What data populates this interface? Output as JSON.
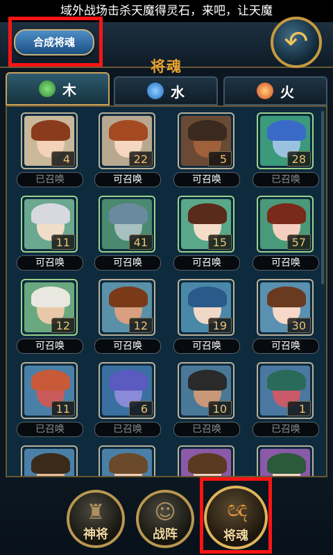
{
  "marquee": "域外战场击杀天魔得灵石，来吧，让天魔",
  "header": {
    "compose_label": "合成将魂",
    "title": "将魂",
    "back_icon": "back-arrow-icon"
  },
  "tabs": [
    {
      "label": "木",
      "icon": "leaf-icon"
    },
    {
      "label": "水",
      "icon": "water-drop-icon"
    },
    {
      "label": "火",
      "icon": "fire-icon"
    }
  ],
  "cards": [
    {
      "count": "4",
      "status": "已召唤",
      "state": "done",
      "bg": "#c9b89a",
      "hair": "#8a3b1e",
      "skin": "#f2d2b8",
      "frame": "plain"
    },
    {
      "count": "22",
      "status": "可召唤",
      "state": "can",
      "bg": "#b9a890",
      "hair": "#a44a22",
      "skin": "#f5d7c0",
      "frame": "plain"
    },
    {
      "count": "5",
      "status": "可召唤",
      "state": "can",
      "bg": "#6b4a35",
      "hair": "#3a2a20",
      "skin": "#a0603a",
      "frame": "plain"
    },
    {
      "count": "28",
      "status": "已召唤",
      "state": "done",
      "bg": "#3a9a7a",
      "hair": "#3a6ac8",
      "skin": "#9ac2e0",
      "frame": "green"
    },
    {
      "count": "11",
      "status": "可召唤",
      "state": "can",
      "bg": "#6aa890",
      "hair": "#d8d8e0",
      "skin": "#f0dcc8",
      "frame": "green"
    },
    {
      "count": "41",
      "status": "可召唤",
      "state": "can",
      "bg": "#4a8a70",
      "hair": "#6a8aa0",
      "skin": "#a8c0c0",
      "frame": "green"
    },
    {
      "count": "15",
      "status": "可召唤",
      "state": "can",
      "bg": "#5aa88a",
      "hair": "#5a2a1a",
      "skin": "#f5dcc8",
      "frame": "green"
    },
    {
      "count": "57",
      "status": "可召唤",
      "state": "can",
      "bg": "#4a9a7a",
      "hair": "#7a2a1a",
      "skin": "#f5d0c0",
      "frame": "green"
    },
    {
      "count": "12",
      "status": "可召唤",
      "state": "can",
      "bg": "#6aa880",
      "hair": "#e8e8e0",
      "skin": "#e8c8a8",
      "frame": "green"
    },
    {
      "count": "12",
      "status": "可召唤",
      "state": "can",
      "bg": "#5a90a8",
      "hair": "#7a3a1a",
      "skin": "#d8a080",
      "frame": "plain"
    },
    {
      "count": "19",
      "status": "可召唤",
      "state": "can",
      "bg": "#4a88a8",
      "hair": "#2a5a8a",
      "skin": "#f0d8c8",
      "frame": "plain"
    },
    {
      "count": "30",
      "status": "可召唤",
      "state": "can",
      "bg": "#5a90b0",
      "hair": "#6a3a20",
      "skin": "#f5d8c8",
      "frame": "plain"
    },
    {
      "count": "11",
      "status": "已召唤",
      "state": "done",
      "bg": "#4a80a8",
      "hair": "#c85a3a",
      "skin": "#c85a5a",
      "frame": "plain"
    },
    {
      "count": "6",
      "status": "已召唤",
      "state": "done",
      "bg": "#3a70a0",
      "hair": "#5a5ac0",
      "skin": "#8a8ad8",
      "frame": "plain"
    },
    {
      "count": "10",
      "status": "已召唤",
      "state": "done",
      "bg": "#4a7898",
      "hair": "#2a2a2a",
      "skin": "#c89878",
      "frame": "plain"
    },
    {
      "count": "1",
      "status": "已召唤",
      "state": "done",
      "bg": "#4a78a0",
      "hair": "#2a6a5a",
      "skin": "#c85a6a",
      "frame": "plain"
    },
    {
      "count": "",
      "status": "",
      "state": "",
      "bg": "#4a80a8",
      "hair": "#3a2a1a",
      "skin": "#e8c0a0",
      "frame": "plain"
    },
    {
      "count": "",
      "status": "",
      "state": "",
      "bg": "#4a80a8",
      "hair": "#6a4a2a",
      "skin": "#f0d0b8",
      "frame": "plain"
    },
    {
      "count": "",
      "status": "",
      "state": "",
      "bg": "#8a5aa8",
      "hair": "#5a3a20",
      "skin": "#f0d0c0",
      "frame": "plain"
    },
    {
      "count": "",
      "status": "",
      "state": "",
      "bg": "#8a5aa8",
      "hair": "#2a5a3a",
      "skin": "#f5d8c8",
      "frame": "plain"
    }
  ],
  "bottom_nav": [
    {
      "label": "神将",
      "icon": "helmet-icon",
      "active": false
    },
    {
      "label": "战阵",
      "icon": "formation-people-icon",
      "active": false
    },
    {
      "label": "将魂",
      "icon": "soul-flame-icon",
      "active": true
    }
  ],
  "colors": {
    "accent": "#e8a22e",
    "highlight": "#ff1414"
  }
}
